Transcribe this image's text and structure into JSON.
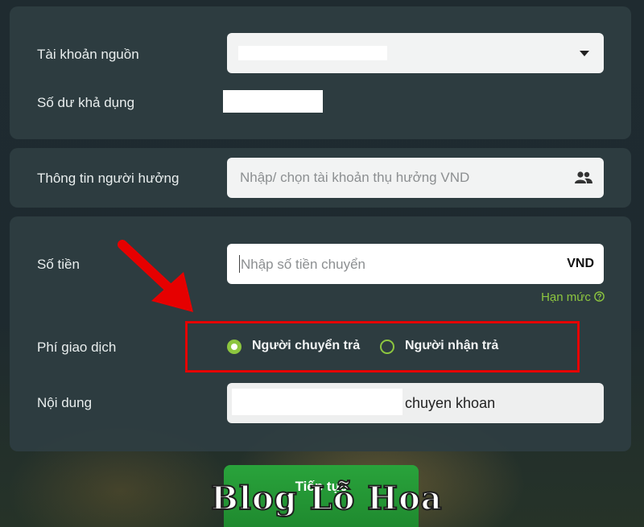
{
  "source": {
    "label": "Tài khoản nguồn",
    "balance_label": "Số dư khả dụng"
  },
  "beneficiary": {
    "label": "Thông tin người hưởng",
    "placeholder": "Nhập/ chọn tài khoản thụ hưởng VND"
  },
  "amount": {
    "label": "Số tiền",
    "placeholder": "Nhập số tiền chuyển",
    "currency": "VND",
    "limit_link": "Hạn mức"
  },
  "fee": {
    "label": "Phí giao dịch",
    "options": [
      {
        "label": "Người chuyển trả",
        "selected": true
      },
      {
        "label": "Người nhận trả",
        "selected": false
      }
    ]
  },
  "content": {
    "label": "Nội dung",
    "value": "chuyen khoan"
  },
  "continue_label": "Tiếp tục",
  "watermark": "Blog Lỗ Hoa",
  "colors": {
    "accent_green": "#8dc63f",
    "annotation_red": "#e60000"
  }
}
